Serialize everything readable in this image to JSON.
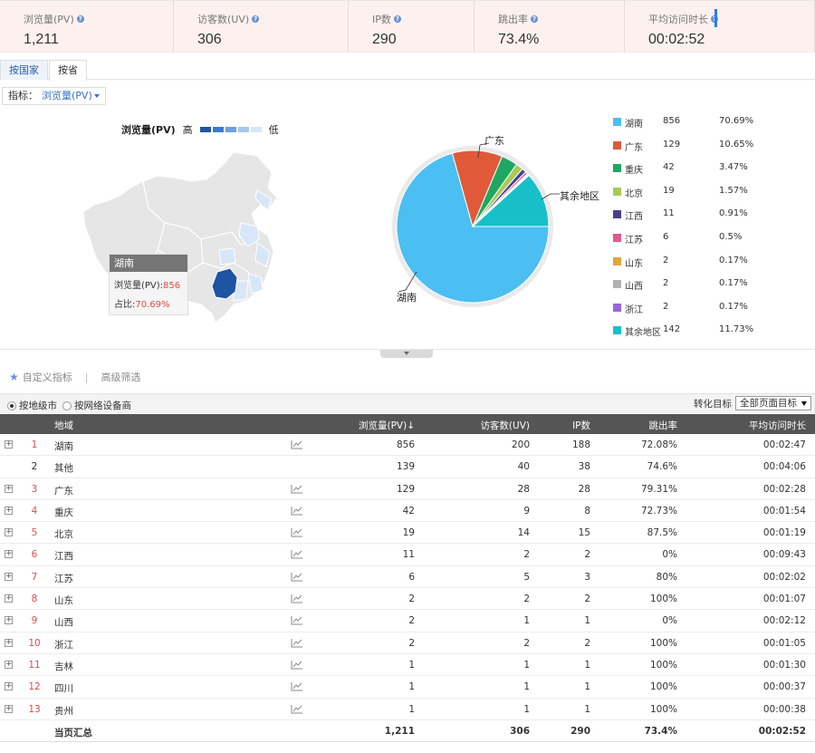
{
  "summary": [
    {
      "label": "浏览量(PV)",
      "value": "1,211"
    },
    {
      "label": "访客数(UV)",
      "value": "306"
    },
    {
      "label": "IP数",
      "value": "290"
    },
    {
      "label": "跳出率",
      "value": "73.4%"
    },
    {
      "label": "平均访问时长",
      "value": "00:02:52"
    }
  ],
  "tabs": {
    "country": "按国家",
    "province": "按省"
  },
  "indicator": {
    "label": "指标：",
    "selected": "浏览量(PV)"
  },
  "map_legend": {
    "title": "浏览量(PV)",
    "high": "高",
    "low": "低",
    "colors": [
      "#1d55a3",
      "#3a7bd0",
      "#6ca0e0",
      "#a7c8ef",
      "#d7e6f8"
    ]
  },
  "tooltip": {
    "title": "湖南",
    "pv_label": "浏览量(PV):",
    "pv_value": "856",
    "ratio_label": "占比:",
    "ratio_value": "70.69%"
  },
  "pie": {
    "labels": {
      "hunan": "湖南",
      "guangdong": "广东",
      "rest": "其余地区"
    },
    "slices": [
      {
        "name": "湖南",
        "count": "856",
        "pct": "70.69%",
        "value": 70.69,
        "color": "#4bbef2"
      },
      {
        "name": "广东",
        "count": "129",
        "pct": "10.65%",
        "value": 10.65,
        "color": "#e05a3a"
      },
      {
        "name": "重庆",
        "count": "42",
        "pct": "3.47%",
        "value": 3.47,
        "color": "#1fa862"
      },
      {
        "name": "北京",
        "count": "19",
        "pct": "1.57%",
        "value": 1.57,
        "color": "#a8c957"
      },
      {
        "name": "江西",
        "count": "11",
        "pct": "0.91%",
        "value": 0.91,
        "color": "#4a3f8f"
      },
      {
        "name": "江苏",
        "count": "6",
        "pct": "0.5%",
        "value": 0.5,
        "color": "#e05a8f"
      },
      {
        "name": "山东",
        "count": "2",
        "pct": "0.17%",
        "value": 0.17,
        "color": "#e6a43a"
      },
      {
        "name": "山西",
        "count": "2",
        "pct": "0.17%",
        "value": 0.17,
        "color": "#b3b3b3"
      },
      {
        "name": "浙江",
        "count": "2",
        "pct": "0.17%",
        "value": 0.17,
        "color": "#9966e0"
      },
      {
        "name": "其余地区",
        "count": "142",
        "pct": "11.73%",
        "value": 11.73,
        "color": "#17c0c8"
      }
    ]
  },
  "toolbar": {
    "custom": "自定义指标",
    "separator": "|",
    "advanced": "高级筛选"
  },
  "filters": {
    "by_city": "按地级市",
    "by_isp": "按网络设备商",
    "goal_label": "转化目标",
    "goal_value": "全部页面目标"
  },
  "table": {
    "headers": {
      "region": "地域",
      "pv": "浏览量(PV)",
      "pv_arrow": "↓",
      "uv": "访客数(UV)",
      "ip": "IP数",
      "bounce": "跳出率",
      "avg": "平均访问时长"
    },
    "rows": [
      {
        "idx": "1",
        "name": "湖南",
        "pv": "856",
        "uv": "200",
        "ip": "188",
        "bounce": "72.08%",
        "avg": "00:02:47"
      },
      {
        "idx": "2",
        "name": "其他",
        "pv": "139",
        "uv": "40",
        "ip": "38",
        "bounce": "74.6%",
        "avg": "00:04:06"
      },
      {
        "idx": "3",
        "name": "广东",
        "pv": "129",
        "uv": "28",
        "ip": "28",
        "bounce": "79.31%",
        "avg": "00:02:28"
      },
      {
        "idx": "4",
        "name": "重庆",
        "pv": "42",
        "uv": "9",
        "ip": "8",
        "bounce": "72.73%",
        "avg": "00:01:54"
      },
      {
        "idx": "5",
        "name": "北京",
        "pv": "19",
        "uv": "14",
        "ip": "15",
        "bounce": "87.5%",
        "avg": "00:01:19"
      },
      {
        "idx": "6",
        "name": "江西",
        "pv": "11",
        "uv": "2",
        "ip": "2",
        "bounce": "0%",
        "avg": "00:09:43"
      },
      {
        "idx": "7",
        "name": "江苏",
        "pv": "6",
        "uv": "5",
        "ip": "3",
        "bounce": "80%",
        "avg": "00:02:02"
      },
      {
        "idx": "8",
        "name": "山东",
        "pv": "2",
        "uv": "2",
        "ip": "2",
        "bounce": "100%",
        "avg": "00:01:07"
      },
      {
        "idx": "9",
        "name": "山西",
        "pv": "2",
        "uv": "1",
        "ip": "1",
        "bounce": "0%",
        "avg": "00:02:12"
      },
      {
        "idx": "10",
        "name": "浙江",
        "pv": "2",
        "uv": "2",
        "ip": "2",
        "bounce": "100%",
        "avg": "00:01:05"
      },
      {
        "idx": "11",
        "name": "吉林",
        "pv": "1",
        "uv": "1",
        "ip": "1",
        "bounce": "100%",
        "avg": "00:01:30"
      },
      {
        "idx": "12",
        "name": "四川",
        "pv": "1",
        "uv": "1",
        "ip": "1",
        "bounce": "100%",
        "avg": "00:00:37"
      },
      {
        "idx": "13",
        "name": "贵州",
        "pv": "1",
        "uv": "1",
        "ip": "1",
        "bounce": "100%",
        "avg": "00:00:38"
      }
    ],
    "total": {
      "label": "当页汇总",
      "pv": "1,211",
      "uv": "306",
      "ip": "290",
      "bounce": "73.4%",
      "avg": "00:02:52"
    }
  }
}
